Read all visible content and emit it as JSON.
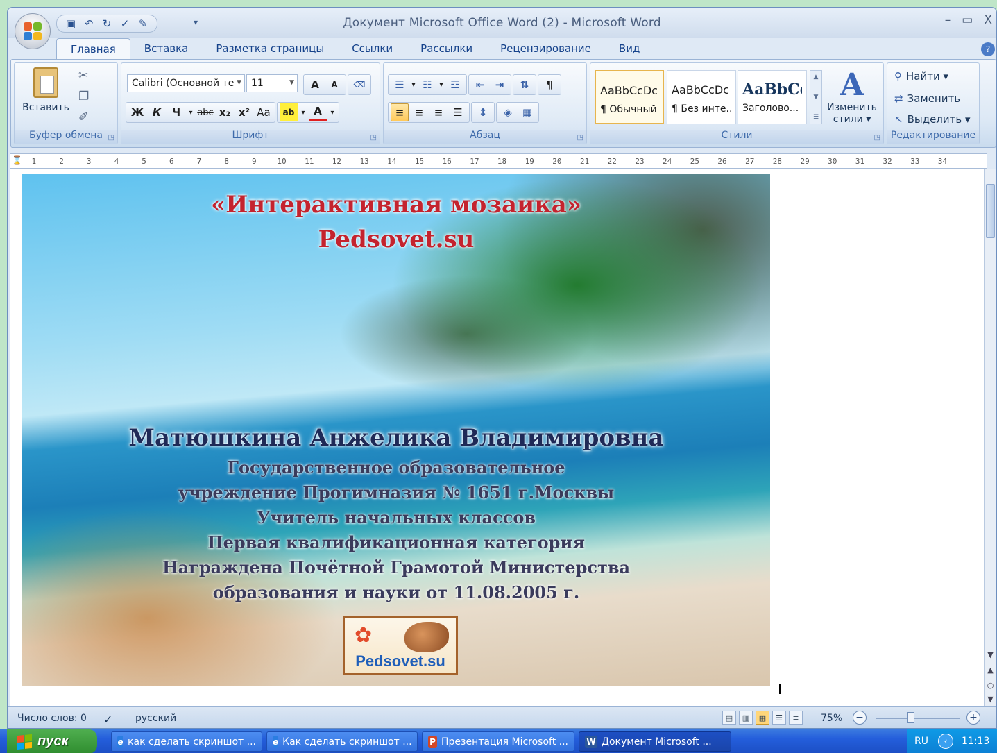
{
  "window": {
    "title": "Документ Microsoft Office Word (2) - Microsoft Word",
    "controls": [
      "–",
      "▭",
      "X"
    ]
  },
  "quick_access": {
    "icons": [
      "save-icon",
      "undo-icon",
      "redo-icon",
      "spellcheck-icon",
      "edit-icon"
    ],
    "more": "▾"
  },
  "tabs": [
    "Главная",
    "Вставка",
    "Разметка страницы",
    "Ссылки",
    "Рассылки",
    "Рецензирование",
    "Вид"
  ],
  "active_tab": "Главная",
  "ribbon": {
    "clipboard": {
      "paste_label": "Вставить",
      "group_label": "Буфер обмена"
    },
    "font": {
      "font_name": "Calibri (Основной те",
      "font_size": "11",
      "group_label": "Шрифт",
      "grow": "A",
      "shrink": "A",
      "bold": "Ж",
      "italic": "К",
      "underline": "Ч",
      "strike": "abc",
      "subscript": "x₂",
      "superscript": "x²",
      "case": "Aa",
      "highlight": "ab",
      "font_color": "A"
    },
    "paragraph": {
      "group_label": "Абзац",
      "pilcrow": "¶"
    },
    "styles": {
      "group_label": "Стили",
      "tiles": [
        {
          "sample": "AaBbCcDc",
          "name": "¶ Обычный"
        },
        {
          "sample": "AaBbCcDc",
          "name": "¶ Без инте..."
        },
        {
          "sample": "AaBbCc",
          "name": "Заголово..."
        }
      ],
      "change_label_1": "Изменить",
      "change_label_2": "стили ▾"
    },
    "editing": {
      "group_label": "Редактирование",
      "find": "Найти ▾",
      "replace": "Заменить",
      "select": "Выделить ▾"
    }
  },
  "ruler": {
    "ticks": [
      "1",
      "2",
      "3",
      "4",
      "5",
      "6",
      "7",
      "8",
      "9",
      "10",
      "11",
      "12",
      "13",
      "14",
      "15",
      "16",
      "17",
      "18",
      "19",
      "20",
      "21",
      "22",
      "23",
      "24",
      "25",
      "26",
      "27",
      "28",
      "29",
      "30",
      "31",
      "32",
      "33",
      "34"
    ]
  },
  "document": {
    "line_title": "«Интерактивная мозаика»",
    "line_site": "Pedsovet.su",
    "author": "Матюшкина Анжелика Владимировна",
    "lines": [
      "Государственное образовательное",
      "учреждение  Прогимназия № 1651 г.Москвы",
      "Учитель начальных классов",
      "Первая квалификационная категория",
      "Награждена Почётной Грамотой Министерства",
      "образования и науки от 11.08.2005 г."
    ],
    "logo_text": "Pedsovet.su"
  },
  "statusbar": {
    "word_count": "Число слов: 0",
    "language": "русский",
    "zoom": "75%",
    "zoom_level_percent": 75
  },
  "taskbar": {
    "start": "пуск",
    "items": [
      "как сделать скриншот ...",
      "Как сделать скриншот ...",
      "Презентация Microsoft ...",
      "Документ Microsoft ..."
    ],
    "lang": "RU",
    "time": "11:13"
  },
  "colors": {
    "accent": "#15428b",
    "taskbar": "#245edb",
    "start": "#3a9a3a",
    "title_red": "#c4232e"
  }
}
